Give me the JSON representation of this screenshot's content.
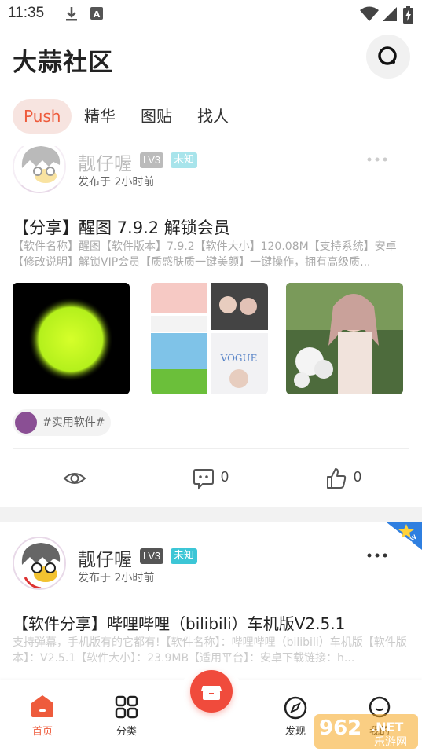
{
  "status_bar": {
    "time": "11:35"
  },
  "header": {
    "title": "大蒜社区",
    "tabs": [
      "Push",
      "精华",
      "图贴",
      "找人"
    ],
    "active_tab": "Push",
    "accent_color": "#ee5b3c"
  },
  "posts": [
    {
      "username": "靓仔喔",
      "level": "LV3",
      "gender": "未知",
      "time": "发布于 2小时前",
      "title": "【分享】醒图 7.9.2 解锁会员",
      "excerpt": "【软件名称】醒图【软件版本】7.9.2【软件大小】120.08M【支持系统】安卓【修改说明】解锁VIP会员【质感肤质一键美颜】一键操作，拥有高级质...",
      "topic": "#实用软件#",
      "views": "",
      "comments": "0",
      "likes": "0"
    },
    {
      "username": "靓仔喔",
      "level": "LV3",
      "gender": "未知",
      "time": "发布于 2小时前",
      "title": "【软件分享】哔哩哔哩（bilibili）车机版V2.5.1",
      "excerpt": "支持弹幕，手机版有的它都有!【软件名称】：哔哩哔哩（bilibili）车机版【软件版本】：V2.5.1【软件大小】：23.9MB【适用平台】：安卓下载链接：h...",
      "badge": "NEW"
    }
  ],
  "bottom_nav": {
    "items": [
      "首页",
      "分类",
      "",
      "发现",
      "我的"
    ],
    "active": "首页"
  },
  "watermark": {
    "text": "962",
    "suffix": ".NET",
    "sub": "乐游网"
  }
}
